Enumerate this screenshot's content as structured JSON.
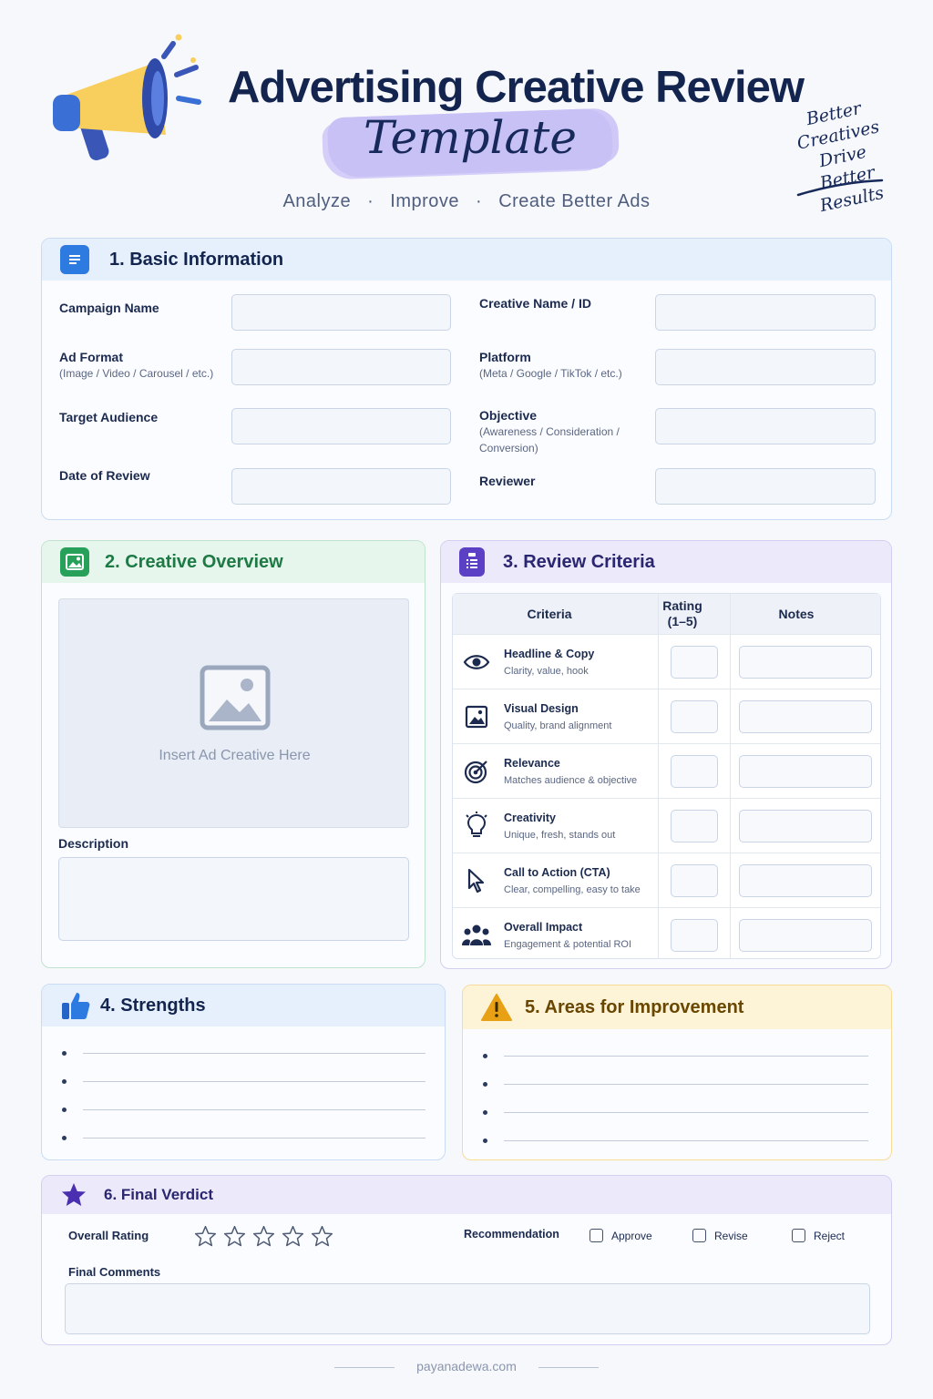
{
  "header": {
    "title": "Advertising Creative Review",
    "script_title": "Template",
    "tagline": [
      "Analyze",
      "Improve",
      "Create Better Ads"
    ],
    "motto": [
      "Better",
      "Creatives",
      "Drive",
      "Better Results"
    ]
  },
  "basic": {
    "title": "1. Basic Information",
    "fields": [
      {
        "label": "Campaign Name",
        "sub": ""
      },
      {
        "label": "Creative Name / ID",
        "sub": ""
      },
      {
        "label": "Ad Format",
        "sub": "(Image / Video / Carousel / etc.)"
      },
      {
        "label": "Platform",
        "sub": "(Meta / Google / TikTok / etc.)"
      },
      {
        "label": "Target Audience",
        "sub": ""
      },
      {
        "label": "Objective",
        "sub": "(Awareness / Consideration / Conversion)"
      },
      {
        "label": "Date of Review",
        "sub": ""
      },
      {
        "label": "Reviewer",
        "sub": ""
      }
    ]
  },
  "overview": {
    "title": "2. Creative Overview",
    "placeholder": "Insert Ad Creative Here",
    "description_label": "Description"
  },
  "criteria": {
    "title": "3. Review Criteria",
    "headers": {
      "criteria": "Criteria",
      "rating": "Rating (1–5)",
      "notes": "Notes"
    },
    "rows": [
      {
        "name": "Headline & Copy",
        "sub": "Clarity, value, hook",
        "icon": "eye-icon"
      },
      {
        "name": "Visual Design",
        "sub": "Quality, brand alignment",
        "icon": "image-icon"
      },
      {
        "name": "Relevance",
        "sub": "Matches audience & objective",
        "icon": "target-icon"
      },
      {
        "name": "Creativity",
        "sub": "Unique, fresh, stands out",
        "icon": "lightbulb-icon"
      },
      {
        "name": "Call to Action (CTA)",
        "sub": "Clear, compelling, easy to take",
        "icon": "cursor-icon"
      },
      {
        "name": "Overall Impact",
        "sub": "Engagement & potential ROI",
        "icon": "people-icon"
      }
    ]
  },
  "strengths": {
    "title": "4. Strengths",
    "bullets": 4
  },
  "improvement": {
    "title": "5.  Areas for Improvement",
    "bullets": 4
  },
  "verdict": {
    "title": "6. Final Verdict",
    "overall_rating_label": "Overall Rating",
    "stars": 5,
    "recommendation_label": "Recommendation",
    "options": [
      "Approve",
      "Revise",
      "Reject"
    ],
    "final_comments_label": "Final Comments"
  },
  "footer": {
    "site": "payanadewa.com"
  },
  "colors": {
    "navy": "#13254f",
    "blue_accent": "#2d6fd6",
    "green_accent": "#27a05a",
    "purple_accent": "#5b3fc4",
    "amber_accent": "#f0a81c"
  }
}
